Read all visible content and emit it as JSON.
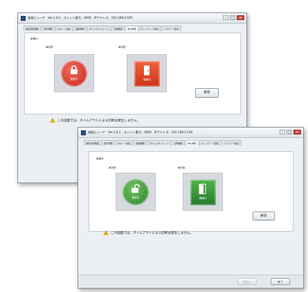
{
  "windows": {
    "back": {
      "title": "施錠ビューア　Ver.1.0.2　ユニット番号：0000　IPアドレス：192.168.0.100",
      "tabs": [
        "施錠状態確認",
        "操作履歴",
        "IDカード設定",
        "施錠権限",
        "タイムスケジュール",
        "定期確認",
        "扉の解錠",
        "ネットワーク設定",
        "バスワード設定"
      ],
      "active_tab_index": 6,
      "panel_title": "扉操作",
      "door1_label": "扉状態：",
      "door2_label": "扉状態：",
      "lock_caption": "施錠中",
      "door_caption": "閉扉中",
      "unlock_button": "解錠",
      "warning": "この画面では、タイムアウトによる切断は発生しません。"
    },
    "front": {
      "title": "施錠ビューア　Ver.1.0.2　ユニット番号：0000　IPアドレス：192.168.0.100",
      "tabs": [
        "施錠状態確認",
        "操作履歴",
        "IDカード設定",
        "施錠権限",
        "タイムスケジュール",
        "定期確認",
        "扉の解錠",
        "ネットワーク設定",
        "バスワード設定"
      ],
      "active_tab_index": 6,
      "panel_title": "扉操作",
      "door1_label": "扉状態：",
      "door2_label": "扉状態：",
      "lock_caption": "解錠中",
      "door_caption": "開扉中",
      "unlock_button": "解錠",
      "warning": "この画面では、タイムアウトによる切断は発生しません。",
      "footer_disabled": "再読込",
      "footer_end": "終了"
    }
  },
  "colors": {
    "locked": "#d9352a",
    "closed_door": "#e0472b",
    "unlocked": "#3e9a3a",
    "open_door": "#2f9a3c"
  },
  "icons": {
    "lock": "padlock-closed-icon",
    "door_closed": "door-closed-icon",
    "unlock": "padlock-open-icon",
    "door_open": "door-open-icon",
    "warning": "warning-triangle-icon"
  }
}
